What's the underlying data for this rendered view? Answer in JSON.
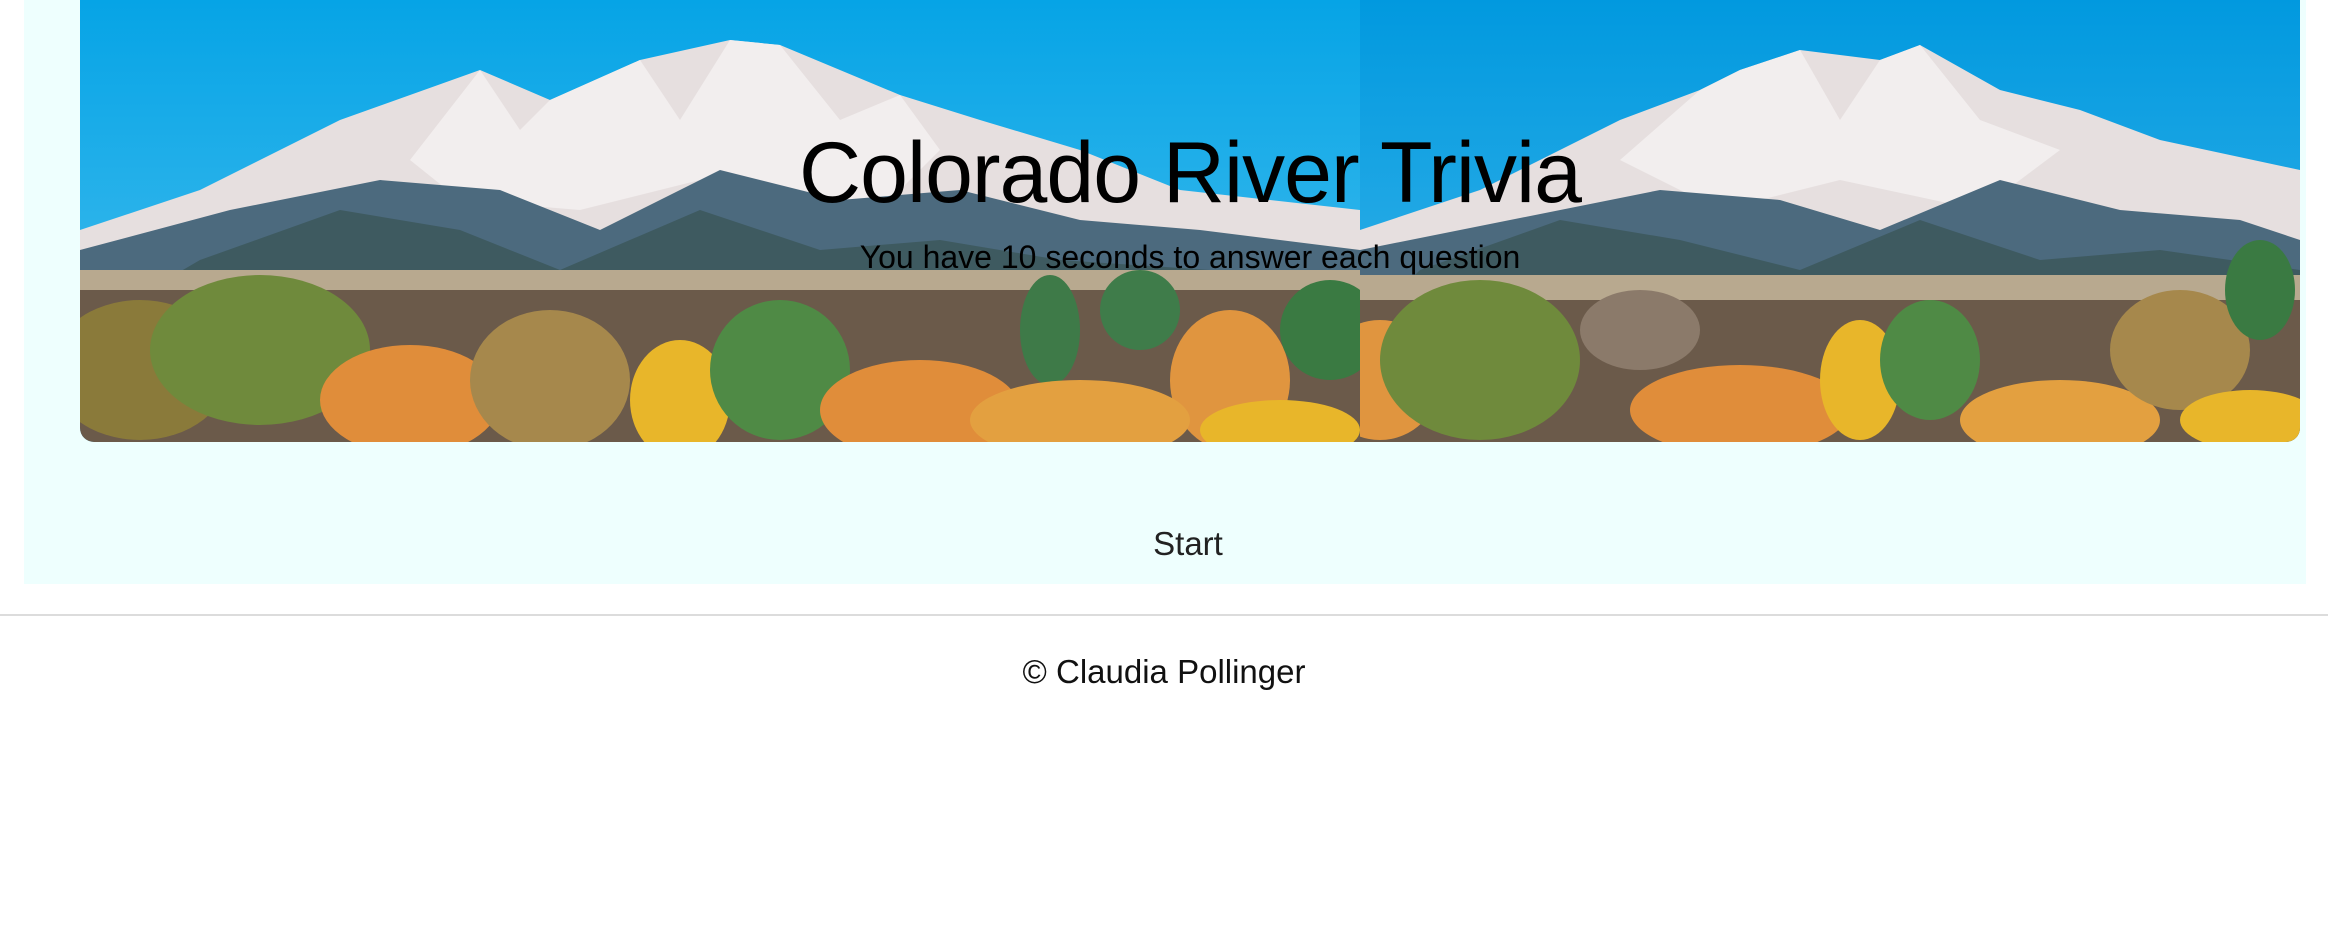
{
  "hero": {
    "title": "Colorado River Trivia",
    "subtitle": "You have 10 seconds to answer each question",
    "image_description_icon": "mountain-landscape-image"
  },
  "actions": {
    "start_label": "Start"
  },
  "footer": {
    "copyright": "© Claudia Pollinger"
  },
  "colors": {
    "panel_background": "#eefffe",
    "sky": "#0aa6e3",
    "mountain_snow": "#e4dede",
    "foliage_orange": "#e8963c",
    "foliage_yellow": "#e8b62a",
    "foliage_green": "#5e8a3a"
  }
}
